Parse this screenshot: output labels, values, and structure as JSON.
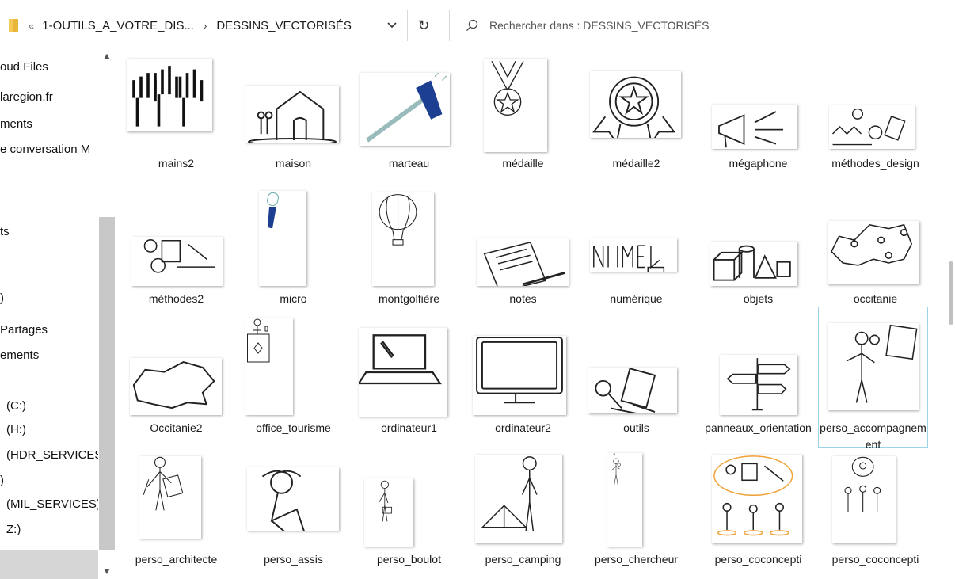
{
  "header": {
    "overflow_chevron": "«",
    "crumb1": "1-OUTILS_A_VOTRE_DIS...",
    "crumb_sep": "›",
    "crumb2": "DESSINS_VECTORISÉS",
    "dropdown_glyph": "⌄",
    "refresh_glyph": "↻",
    "search_placeholder": "Rechercher dans : DESSINS_VECTORISÉS"
  },
  "sidebar": {
    "items": [
      "oud Files",
      "laregion.fr",
      "ments",
      "e conversation M",
      "ts",
      ")",
      "Partages",
      "ements",
      "(C:)",
      "(H:)",
      "(HDR_SERVICES)",
      ")",
      "(MIL_SERVICES)",
      "Z:)"
    ]
  },
  "files": [
    {
      "label": "mains2",
      "icon": "hands-drawing-icon"
    },
    {
      "label": "maison",
      "icon": "house-drawing-icon"
    },
    {
      "label": "marteau",
      "icon": "hammer-drawing-icon"
    },
    {
      "label": "médaille",
      "icon": "medal-drawing-icon"
    },
    {
      "label": "médaille2",
      "icon": "medal2-drawing-icon"
    },
    {
      "label": "mégaphone",
      "icon": "megaphone-drawing-icon"
    },
    {
      "label": "méthodes_design",
      "icon": "methods-design-drawing-icon"
    },
    {
      "label": "méthodes2",
      "icon": "methods2-drawing-icon"
    },
    {
      "label": "micro",
      "icon": "microphone-drawing-icon"
    },
    {
      "label": "montgolfière",
      "icon": "hot-air-balloon-drawing-icon"
    },
    {
      "label": "notes",
      "icon": "notes-drawing-icon"
    },
    {
      "label": "numérique",
      "icon": "digital-drawing-icon"
    },
    {
      "label": "objets",
      "icon": "objects-drawing-icon"
    },
    {
      "label": "occitanie",
      "icon": "occitanie-map-drawing-icon"
    },
    {
      "label": "Occitanie2",
      "icon": "occitanie2-map-drawing-icon"
    },
    {
      "label": "office_tourisme",
      "icon": "tourist-office-drawing-icon"
    },
    {
      "label": "ordinateur1",
      "icon": "laptop-drawing-icon"
    },
    {
      "label": "ordinateur2",
      "icon": "monitor-drawing-icon"
    },
    {
      "label": "outils",
      "icon": "tools-drawing-icon"
    },
    {
      "label": "panneaux_orientation",
      "icon": "signpost-drawing-icon"
    },
    {
      "label": "perso_accompagnement",
      "icon": "person-support-drawing-icon",
      "selected": true
    },
    {
      "label": "perso_architecte",
      "icon": "person-architect-drawing-icon"
    },
    {
      "label": "perso_assis",
      "icon": "person-sitting-drawing-icon"
    },
    {
      "label": "perso_boulot",
      "icon": "person-work-drawing-icon"
    },
    {
      "label": "perso_camping",
      "icon": "person-camping-drawing-icon"
    },
    {
      "label": "perso_chercheur",
      "icon": "person-researcher-drawing-icon"
    },
    {
      "label": "perso_coconcepti",
      "icon": "person-codesign-drawing-icon"
    },
    {
      "label": "perso_coconcepti",
      "icon": "person-codesign2-drawing-icon"
    }
  ],
  "colors": {
    "accent_blue": "#1d3f91",
    "selection_border": "#9dd3e8",
    "folder_yellow": "#e8b73a",
    "orange": "#f0a33a"
  }
}
